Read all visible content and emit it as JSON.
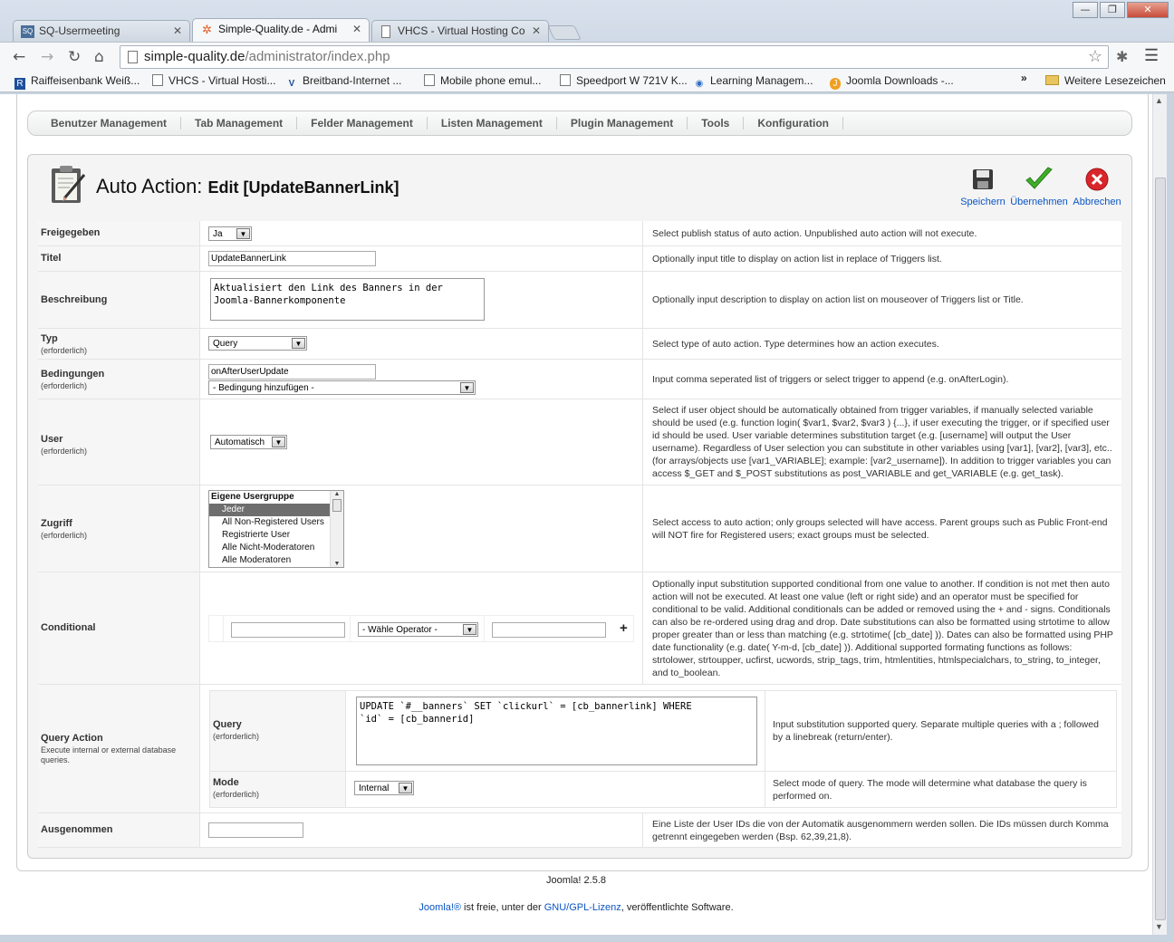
{
  "browser": {
    "tabs": [
      {
        "title": "SQ-Usermeeting",
        "active": false,
        "icon": "sq-favicon"
      },
      {
        "title": "Simple-Quality.de - Admi",
        "active": true,
        "icon": "joomla-favicon"
      },
      {
        "title": "VHCS - Virtual Hosting Co",
        "active": false,
        "icon": "page-favicon"
      }
    ],
    "url_domain": "simple-quality.de",
    "url_path": "/administrator/index.php",
    "bookmarks": [
      "Raiffeisenbank Weiß...",
      "VHCS - Virtual Hosti...",
      "Breitband-Internet ...",
      "Mobile phone emul...",
      "Speedport W 721V K...",
      "Learning Managem...",
      "Joomla Downloads -...",
      "Weitere Lesezeichen"
    ],
    "bookmarks_chevron": "»"
  },
  "submenu": [
    "Benutzer Management",
    "Tab Management",
    "Felder Management",
    "Listen Management",
    "Plugin Management",
    "Tools",
    "Konfiguration"
  ],
  "header": {
    "title": "Auto Action:",
    "subtitle": "Edit [UpdateBannerLink]",
    "save": "Speichern",
    "apply": "Übernehmen",
    "cancel": "Abbrechen"
  },
  "required_text": "(erforderlich)",
  "form": {
    "published": {
      "label": "Freigegeben",
      "value": "Ja",
      "desc": "Select publish status of auto action. Unpublished auto action will not execute."
    },
    "title": {
      "label": "Titel",
      "value": "UpdateBannerLink",
      "desc": "Optionally input title to display on action list in replace of Triggers list."
    },
    "description": {
      "label": "Beschreibung",
      "value": "Aktualisiert den Link des Banners in der\nJoomla-Bannerkomponente",
      "desc": "Optionally input description to display on action list on mouseover of Triggers list or Title."
    },
    "type": {
      "label": "Typ",
      "value": "Query",
      "desc": "Select type of auto action. Type determines how an action executes."
    },
    "conditions": {
      "label": "Bedingungen",
      "value": "onAfterUserUpdate",
      "select": "- Bedingung hinzufügen -",
      "desc": "Input comma seperated list of triggers or select trigger to append (e.g. onAfterLogin)."
    },
    "user": {
      "label": "User",
      "value": "Automatisch",
      "desc": "Select if user object should be automatically obtained from trigger variables, if manually selected variable should be used (e.g. function login( $var1, $var2, $var3 ) {...}, if user executing the trigger, or if specified user id should be used. User variable determines substitution target (e.g. [username] will output the User username). Regardless of User selection you can substitute in other variables using [var1], [var2], [var3], etc.. (for arrays/objects use [var1_VARIABLE]; example: [var2_username]). In addition to trigger variables you can access $_GET and $_POST substitutions as post_VARIABLE and get_VARIABLE (e.g. get_task)."
    },
    "access": {
      "label": "Zugriff",
      "group": "Eigene Usergruppe",
      "items": [
        "Jeder",
        "All Non-Registered Users",
        "Registrierte User",
        "Alle Nicht-Moderatoren",
        "Alle Moderatoren"
      ],
      "selected": "Jeder",
      "desc": "Select access to auto action; only groups selected will have access. Parent groups such as Public Front-end will NOT fire for Registered users; exact groups must be selected."
    },
    "conditional": {
      "label": "Conditional",
      "operator": "- Wähle Operator -",
      "add": "+",
      "desc": "Optionally input substitution supported conditional from one value to another. If condition is not met then auto action will not be executed. At least one value (left or right side) and an operator must be specified for conditional to be valid. Additional conditionals can be added or removed using the + and - signs. Conditionals can also be re-ordered using drag and drop. Date substitutions can also be formatted using strtotime to allow proper greater than or less than matching (e.g. strtotime( [cb_date] )). Dates can also be formatted using PHP date functionality (e.g. date( Y-m-d, [cb_date] )). Additional supported formating functions as follows: strtolower, strtoupper, ucfirst, ucwords, strip_tags, trim, htmlentities, htmlspecialchars, to_string, to_integer, and to_boolean."
    },
    "query_action": {
      "label": "Query Action",
      "sublabel": "Execute internal or external database queries.",
      "query_label": "Query",
      "query_value": "UPDATE `#__banners` SET `clickurl` = [cb_bannerlink] WHERE\n`id` = [cb_bannerid]",
      "query_desc": "Input substitution supported query. Separate multiple queries with a ; followed by a linebreak (return/enter).",
      "mode_label": "Mode",
      "mode_value": "Internal",
      "mode_desc": "Select mode of query. The mode will determine what database the query is performed on."
    },
    "excluded": {
      "label": "Ausgenommen",
      "value": "",
      "desc": "Eine Liste der User IDs die von der Automatik ausgenommern werden sollen. Die IDs müssen durch Komma getrennt eingegeben werden (Bsp. 62,39,21,8)."
    }
  },
  "footer": {
    "version": "Joomla! 2.5.8",
    "joomla_link": "Joomla!®",
    "text1": " ist freie, unter der ",
    "gpl_link": "GNU/GPL-Lizenz",
    "text2": ", veröffentlichte Software."
  }
}
